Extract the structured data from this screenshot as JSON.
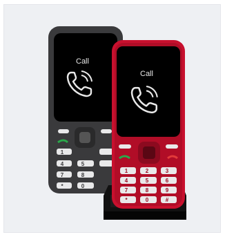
{
  "scene": {
    "description_labels": {
      "back_phone_screen": "Call",
      "front_phone_screen": "Call"
    },
    "keypad": {
      "rows": [
        [
          "1",
          "2",
          "3"
        ],
        [
          "4",
          "5",
          "6"
        ],
        [
          "7",
          "8",
          "9"
        ],
        [
          "*",
          "0",
          "#"
        ]
      ]
    },
    "colors": {
      "background": "#eef0f3",
      "back_phone_body": "#3a3a3c",
      "front_phone_body": "#c8102e",
      "screen": "#000000",
      "key_face": "#e9e9ea",
      "dock": "#111111",
      "call_green": "#2aa84a",
      "end_red": "#e23a3a"
    }
  }
}
